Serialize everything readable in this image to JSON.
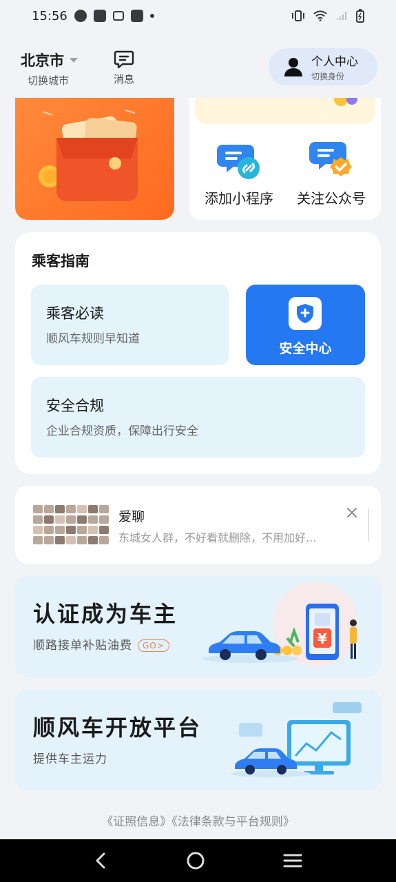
{
  "status_bar": {
    "time": "15:56"
  },
  "header": {
    "city": "北京市",
    "city_switch": "切换城市",
    "messages_label": "消息",
    "profile_title": "个人中心",
    "profile_sub": "切换身份"
  },
  "quick_actions": [
    {
      "label": "添加小程序",
      "icon": "mini-program-icon"
    },
    {
      "label": "关注公众号",
      "icon": "follow-account-icon"
    }
  ],
  "guide": {
    "title": "乘客指南",
    "must_read_title": "乘客必读",
    "must_read_sub": "顺风车规则早知道",
    "safety_center": "安全中心",
    "compliance_title": "安全合规",
    "compliance_sub": "企业合规资质，保障出行安全"
  },
  "chat_group": {
    "name": "爱聊",
    "desc": "东城女人群，不好看就删除，不用加好..."
  },
  "banners": {
    "driver_title": "认证成为车主",
    "driver_sub": "顺路接单补贴油费",
    "driver_go": "GO>",
    "platform_title": "顺风车开放平台",
    "platform_sub": "提供车主运力"
  },
  "footer": {
    "links": "《证照信息》《法律条款与平台规则》"
  },
  "colors": {
    "accent": "#2478f2",
    "promo": "#ff7a2a",
    "tile_bg": "#e5f4fb"
  }
}
